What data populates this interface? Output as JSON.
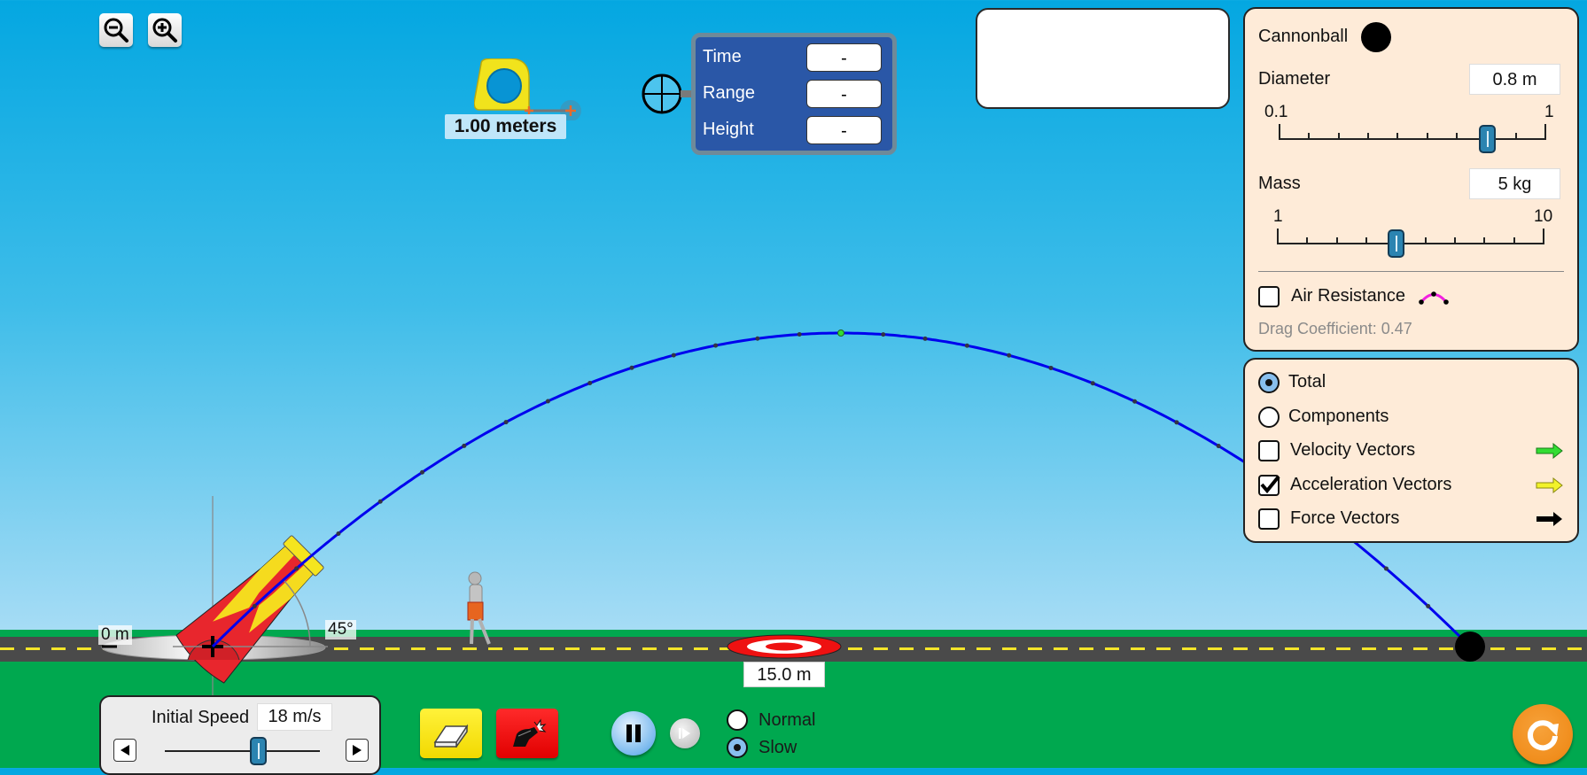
{
  "zoom": {
    "zoom_out": "zoom-out",
    "zoom_in": "zoom-in"
  },
  "tape_measure": {
    "label": "1.00 meters"
  },
  "probe": {
    "rows": [
      {
        "label": "Time",
        "value": "-"
      },
      {
        "label": "Range",
        "value": "-"
      },
      {
        "label": "Height",
        "value": "-"
      }
    ]
  },
  "projectile_panel": {
    "title": "Cannonball",
    "diameter": {
      "label": "Diameter",
      "value": "0.8 m",
      "min_label": "0.1",
      "max_label": "1",
      "min": 0.1,
      "max": 1,
      "current": 0.8
    },
    "mass": {
      "label": "Mass",
      "value": "5 kg",
      "min_label": "1",
      "max_label": "10",
      "min": 1,
      "max": 10,
      "current": 5
    },
    "air_resistance": {
      "label": "Air Resistance",
      "checked": false
    },
    "drag_coefficient": "Drag Coefficient: 0.47"
  },
  "vectors_panel": {
    "mode_options": [
      {
        "label": "Total",
        "selected": true
      },
      {
        "label": "Components",
        "selected": false
      }
    ],
    "checkboxes": [
      {
        "label": "Velocity Vectors",
        "checked": false,
        "color": "#33dd33"
      },
      {
        "label": "Acceleration Vectors",
        "checked": true,
        "color": "#f2f22a"
      },
      {
        "label": "Force Vectors",
        "checked": false,
        "color": "#000000"
      }
    ]
  },
  "scene": {
    "height_label": "0 m",
    "angle_label": "45°",
    "target_label": "15.0 m",
    "angle_degrees": 45
  },
  "speed_panel": {
    "label": "Initial Speed",
    "value": "18 m/s",
    "fraction": 0.6
  },
  "playback": {
    "speed_options": [
      {
        "label": "Normal",
        "selected": false
      },
      {
        "label": "Slow",
        "selected": true
      }
    ]
  },
  "colors": {
    "trajectory": "#0000ee",
    "panel_bg": "#feebd8",
    "probe_bg": "#2a57a7",
    "grass": "#00a84f"
  }
}
